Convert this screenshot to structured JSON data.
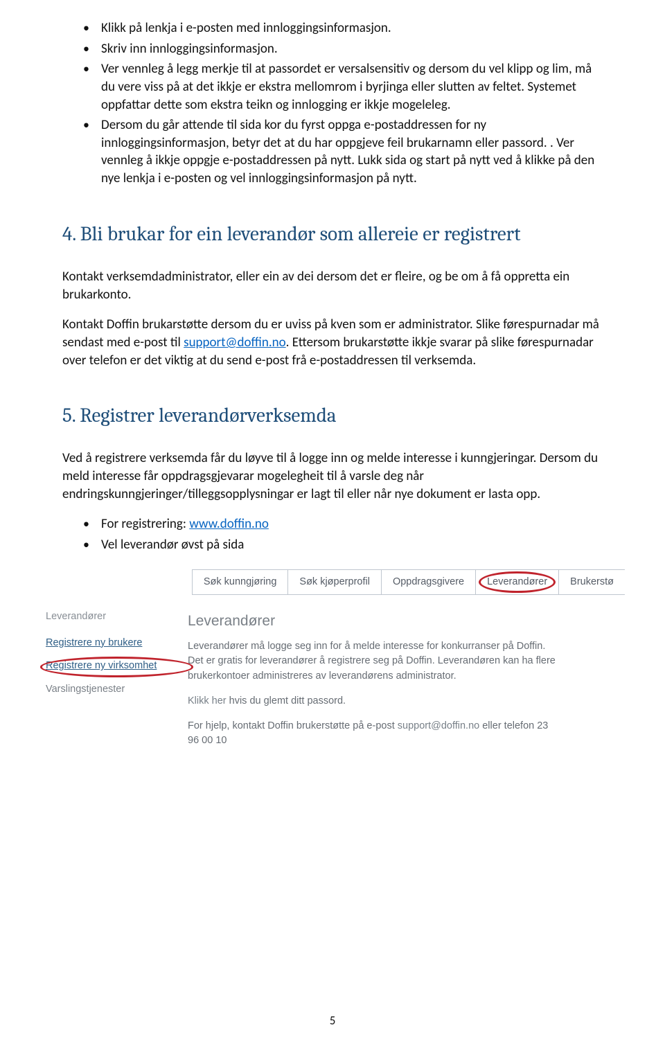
{
  "bullets_top": [
    "Klikk på lenkja i e-posten med innloggingsinformasjon.",
    "Skriv inn innloggingsinformasjon.",
    "Ver vennleg å legg merkje til at passordet er versalsensitiv og dersom du vel klipp og lim, må du vere viss på at det ikkje er ekstra mellomrom i byrjinga eller slutten av feltet. Systemet oppfattar dette som ekstra teikn og innlogging er ikkje mogeleleg.",
    "Dersom du går attende til sida kor du fyrst oppga e-postaddressen for ny innloggingsinformasjon, betyr det at du har oppgjeve feil brukarnamn eller passord. . Ver vennleg å ikkje oppgje e-postaddressen på nytt. Lukk sida og start på nytt ved å klikke på den nye lenkja i e-posten og vel innloggingsinformasjon på nytt."
  ],
  "section4": {
    "title": "4. Bli brukar for ein leverandør som allereie er registrert",
    "p1": "Kontakt verksemdadministrator, eller ein av dei dersom det er fleire, og be om å få oppretta ein brukarkonto.",
    "p2_a": "Kontakt Doffin brukarstøtte dersom du er uviss på kven som er administrator. Slike førespurnadar må sendast med e-post til ",
    "p2_link": "support@doffin.no",
    "p2_b": ". Ettersom brukarstøtte ikkje svarar på slike førespurnadar over telefon er det viktig at du send e-post frå e-postaddressen til verksemda."
  },
  "section5": {
    "title": "5. Registrer leverandørverksemda",
    "p1": "Ved å registrere verksemda får du løyve til å logge inn og melde interesse i kunngjeringar. Dersom du meld interesse får oppdragsgjevarar mogelegheit til  å varsle deg når endringskunngjeringer/tilleggsopplysningar er lagt til eller når nye dokument er lasta opp.",
    "bullets": [
      {
        "pre": "For registrering: ",
        "link": "www.doffin.no",
        "post": ""
      },
      {
        "pre": "Vel  leverandør øvst på sida",
        "link": "",
        "post": ""
      }
    ]
  },
  "screenshot": {
    "tabs": [
      "Søk kunngjøring",
      "Søk kjøperprofil",
      "Oppdragsgivere",
      "Leverandører",
      "Brukerstø"
    ],
    "sidebar": {
      "title": "Leverandører",
      "links": [
        "Registrere ny brukere",
        "Registrere ny virksomhet",
        "Varslingstjenester"
      ]
    },
    "main": {
      "title": "Leverandører",
      "p1": "Leverandører må logge seg inn for å melde interesse for konkurranser på Doffin. Det er gratis for leverandører å registrere seg på Doffin. Leverandøren kan ha flere brukerkontoer administreres av leverandørens administrator.",
      "p2_a": "Klikk her",
      "p2_b": " hvis du glemt ditt passord.",
      "p3_a": "For hjelp, kontakt Doffin brukerstøtte på e-post ",
      "p3_link": "support@doffin.no",
      "p3_b": " eller telefon 23 96 00 10"
    }
  },
  "page_number": "5"
}
